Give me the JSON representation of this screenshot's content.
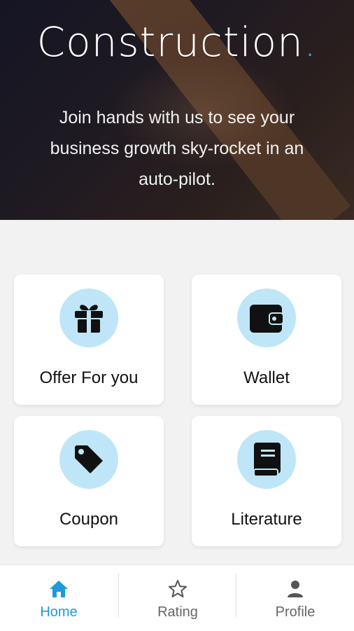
{
  "hero": {
    "title": "Construction",
    "title_dot": ".",
    "subtitle": "Join hands with us to see your business growth sky-rocket in an auto-pilot."
  },
  "cards": [
    {
      "label": "Offer For you",
      "icon": "gift-icon"
    },
    {
      "label": "Wallet",
      "icon": "wallet-icon"
    },
    {
      "label": "Coupon",
      "icon": "tag-icon"
    },
    {
      "label": "Literature",
      "icon": "book-icon"
    }
  ],
  "nav": {
    "items": [
      {
        "label": "Home",
        "icon": "home-icon",
        "active": true
      },
      {
        "label": "Rating",
        "icon": "star-icon",
        "active": false
      },
      {
        "label": "Profile",
        "icon": "user-icon",
        "active": false
      }
    ]
  },
  "colors": {
    "accent": "#1e9ad8",
    "icon_circle": "#bfe6f8",
    "background": "#f2f2f3"
  }
}
